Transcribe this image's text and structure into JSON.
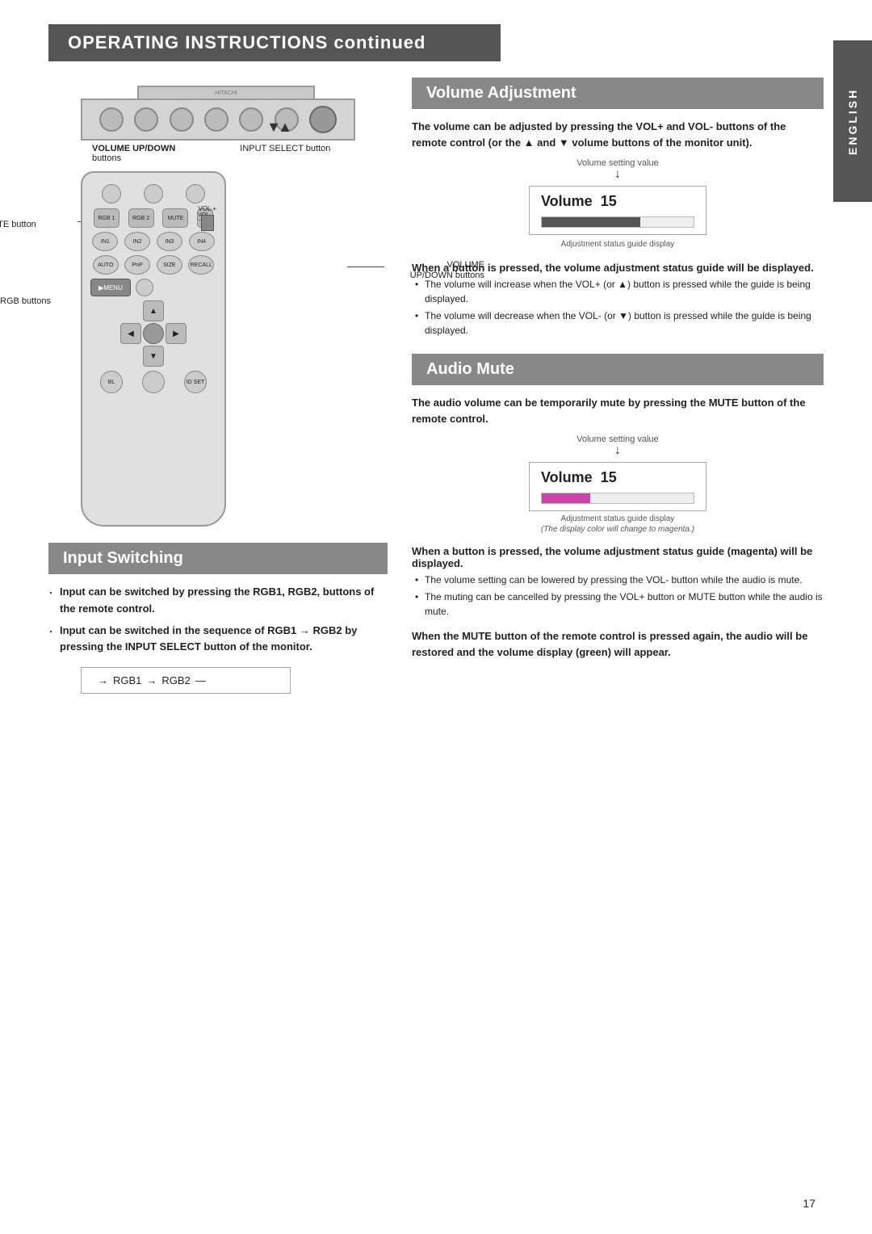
{
  "page": {
    "header": "OPERATING INSTRUCTIONS continued",
    "english_label": "ENGLISH",
    "page_number": "17"
  },
  "volume_adjustment": {
    "section_title": "Volume Adjustment",
    "description": "The volume can be adjusted by pressing the VOL+ and VOL- buttons of the remote control (or the ▲ and ▼ volume buttons of the monitor unit).",
    "volume_setting_label": "Volume setting value",
    "arrow_indicator": "↓",
    "volume_display": "Volume  15",
    "volume_label": "Volume",
    "volume_value": "15",
    "adjustment_label": "Adjustment status guide display",
    "bullet_heading": "When a button is pressed, the volume adjustment status guide will be displayed.",
    "bullet1": "The volume will increase when the VOL+ (or ▲) button is pressed while the guide is being displayed.",
    "bullet2": "The volume will decrease when the VOL- (or ▼) button is pressed while the guide is being displayed."
  },
  "audio_mute": {
    "section_title": "Audio Mute",
    "description": "The audio volume can be temporarily mute by pressing the MUTE button of the remote control.",
    "volume_setting_label": "Volume setting value",
    "arrow_indicator": "↓",
    "volume_display": "Volume  15",
    "volume_label": "Volume",
    "volume_value": "15",
    "adjustment_label": "Adjustment status guide display",
    "adjustment_label2": "(The display color will change to magenta.)",
    "bullet_heading": "When a button is pressed, the volume adjustment status guide (magenta) will be displayed.",
    "bullet1": "The volume setting can be lowered by pressing the VOL- button while the audio is mute.",
    "bullet2": "The muting can be cancelled by pressing the VOL+ button or MUTE button while the audio is mute.",
    "final_heading": "When the MUTE button of the remote control is pressed again, the audio will be restored and the volume display (green) will appear."
  },
  "input_switching": {
    "section_title": "Input Switching",
    "bullet1_bold": "Input can be switched by pressing the RGB1, RGB2, buttons of the remote control.",
    "bullet2_bold": "Input can be switched in the sequence of RGB1 → RGB2 by pressing the INPUT SELECT button of the monitor.",
    "flow_label1": "RGB1",
    "flow_arrow1": "→",
    "flow_label2": "RGB2",
    "flow_arrow_prefix": "→",
    "flow_arrow_suffix": "—"
  },
  "monitor_labels": {
    "hitachi": "HITACHI",
    "volume_up_down": "VOLUME UP/DOWN",
    "buttons": "buttons",
    "input_select": "INPUT SELECT button"
  },
  "remote_labels": {
    "mute_button": "MUTE button",
    "rgb_buttons": "RGB buttons",
    "volume": "VOLUME",
    "up_down_buttons": "UP/DOWN buttons"
  }
}
